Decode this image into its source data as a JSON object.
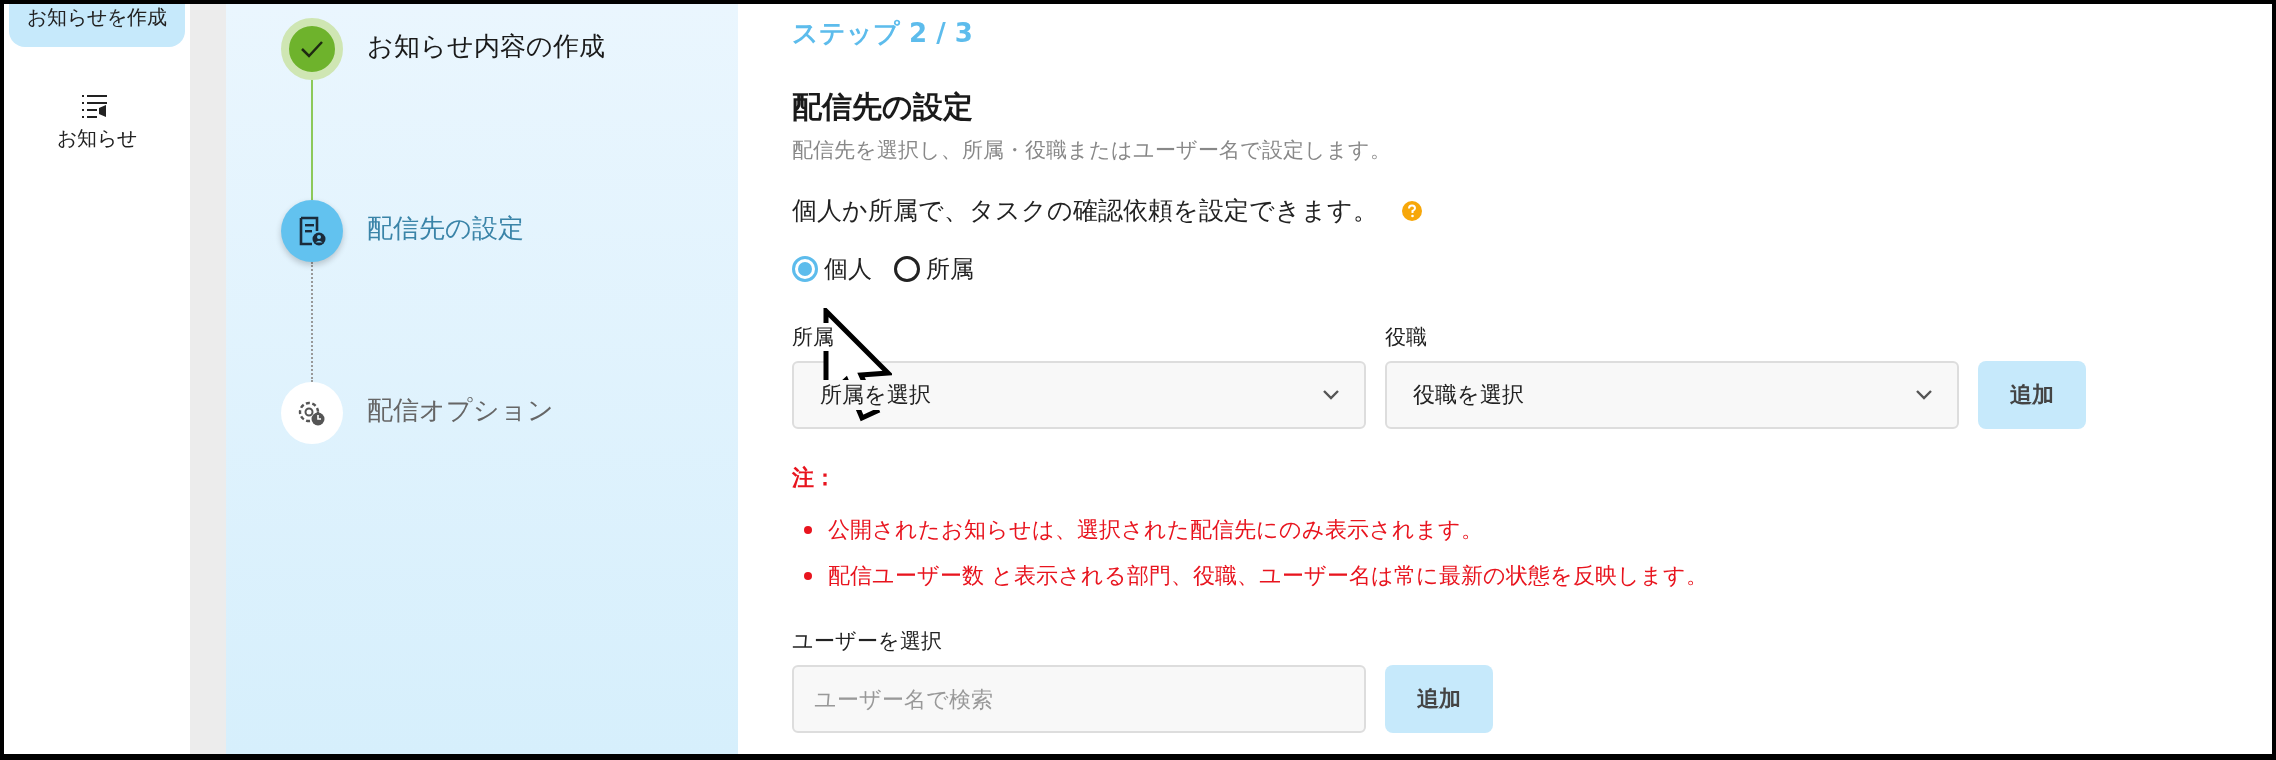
{
  "sidebar": {
    "items": [
      {
        "label": "お知らせを作成",
        "selected": true,
        "kind": "text"
      },
      {
        "label": "お知らせ",
        "selected": false,
        "kind": "icon"
      }
    ]
  },
  "stepper": {
    "steps": [
      {
        "label": "お知らせ内容の作成",
        "kind": "done"
      },
      {
        "label": "配信先の設定",
        "kind": "current"
      },
      {
        "label": "配信オプション",
        "kind": "pending"
      }
    ]
  },
  "form": {
    "step_label": "ステップ 2 / 3",
    "title": "配信先の設定",
    "subtitle": "配信先を選択し、所属・役職またはユーザー名で設定します。",
    "question": "個人か所属で、タスクの確認依頼を設定できます。",
    "radios": [
      {
        "label": "個人",
        "selected": true
      },
      {
        "label": "所属",
        "selected": false
      }
    ],
    "selects": [
      {
        "label": "所属",
        "placeholder": "所属を選択"
      },
      {
        "label": "役職",
        "placeholder": "役職を選択"
      }
    ],
    "add_button": "追加",
    "note_title": "注：",
    "notes": [
      "公開されたお知らせは、選択された配信先にのみ表示されます。",
      "配信ユーザー数 と表示される部門、役職、ユーザー名は常に最新の状態を反映します。"
    ],
    "user_label": "ユーザーを選択",
    "user_search": {
      "placeholder": "ユーザー名で検索"
    },
    "user_add_button": "追加"
  }
}
